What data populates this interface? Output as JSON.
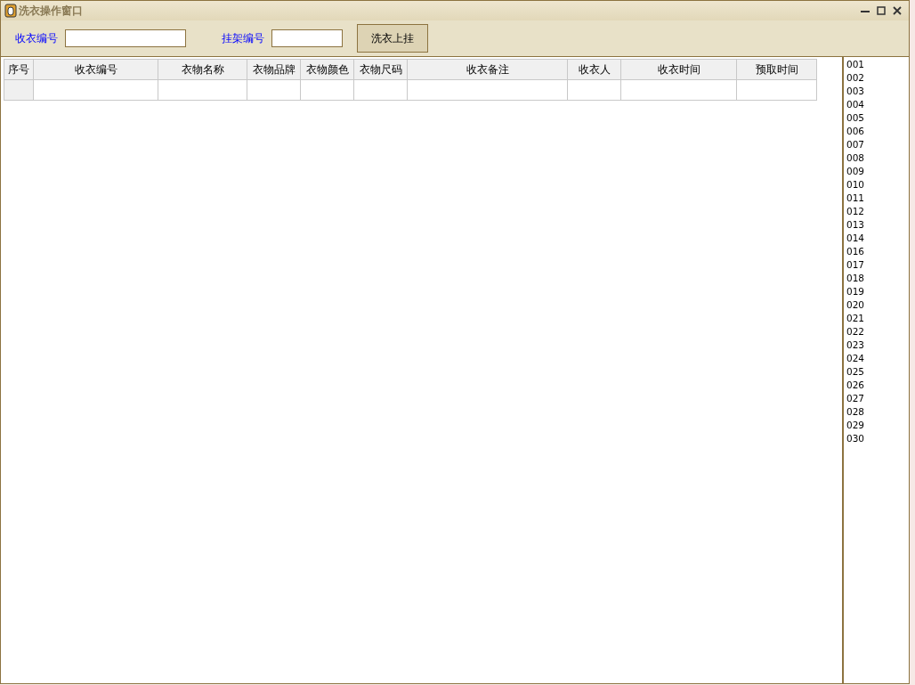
{
  "window": {
    "title": "洗衣操作窗口"
  },
  "toolbar": {
    "fields": [
      {
        "label": "收衣编号"
      },
      {
        "label": "挂架编号"
      }
    ],
    "button": "洗衣上挂"
  },
  "table": {
    "columns": [
      "序号",
      "收衣编号",
      "衣物名称",
      "衣物品牌",
      "衣物颜色",
      "衣物尺码",
      "收衣备注",
      "收衣人",
      "收衣时间",
      "预取时间"
    ]
  },
  "rack_list": [
    "001",
    "002",
    "003",
    "004",
    "005",
    "006",
    "007",
    "008",
    "009",
    "010",
    "011",
    "012",
    "013",
    "014",
    "016",
    "017",
    "018",
    "019",
    "020",
    "021",
    "022",
    "023",
    "024",
    "025",
    "026",
    "027",
    "028",
    "029",
    "030"
  ]
}
